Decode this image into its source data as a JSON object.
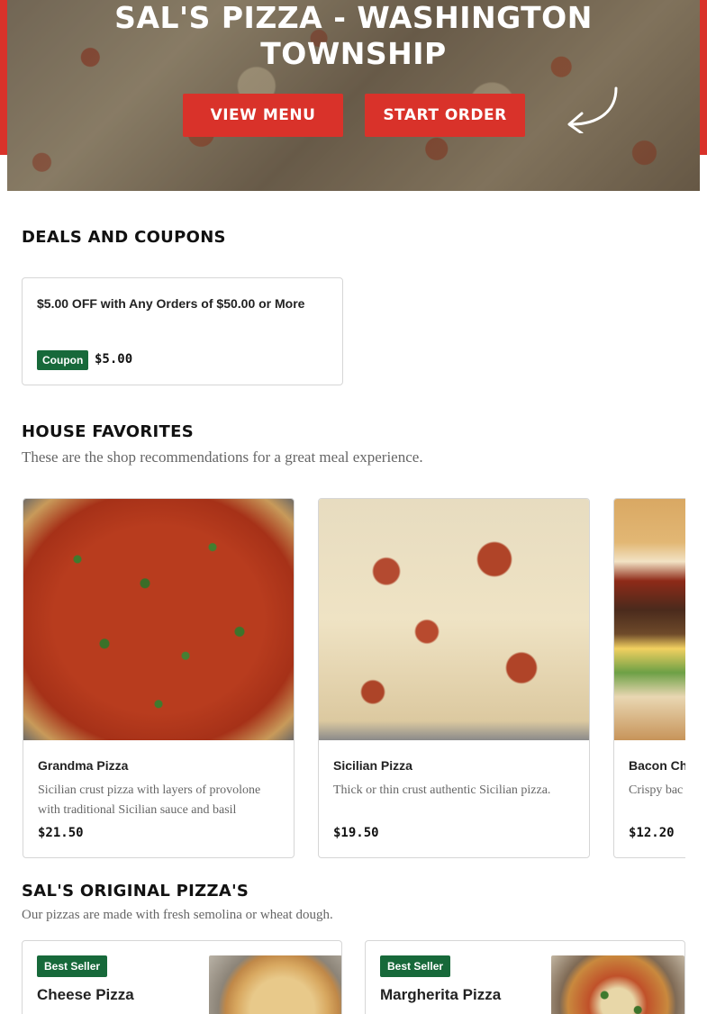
{
  "hero": {
    "title_line1": "SAL'S PIZZA - WASHINGTON",
    "title_line2": "TOWNSHIP",
    "view_menu_label": "VIEW MENU",
    "start_order_label": "START ORDER",
    "arrow_icon": "curved-arrow-left-icon"
  },
  "deals": {
    "heading": "DEALS AND COUPONS",
    "coupons": [
      {
        "text": "$5.00 OFF with Any Orders of $50.00 or More",
        "badge": "Coupon",
        "amount": "$5.00"
      }
    ]
  },
  "favorites": {
    "heading": "HOUSE FAVORITES",
    "subtitle": "These are the shop recommendations for a great meal experience.",
    "items": [
      {
        "name": "Grandma Pizza",
        "description": "Sicilian crust pizza with layers of provolone with traditional Sicilian sauce and basil",
        "price": "$21.50"
      },
      {
        "name": "Sicilian Pizza",
        "description": "Thick or thin crust authentic Sicilian pizza.",
        "price": "$19.50"
      },
      {
        "name": "Bacon Ch",
        "description": "Crispy bac",
        "price": "$12.20"
      }
    ]
  },
  "originals": {
    "heading": "SAL'S ORIGINAL PIZZA'S",
    "subtitle": "Our pizzas are made with fresh semolina or wheat dough.",
    "items": [
      {
        "badge": "Best Seller",
        "name": "Cheese Pizza"
      },
      {
        "badge": "Best Seller",
        "name": "Margherita Pizza"
      }
    ]
  },
  "colors": {
    "brand_red": "#d9322a",
    "badge_green": "#17693a"
  }
}
